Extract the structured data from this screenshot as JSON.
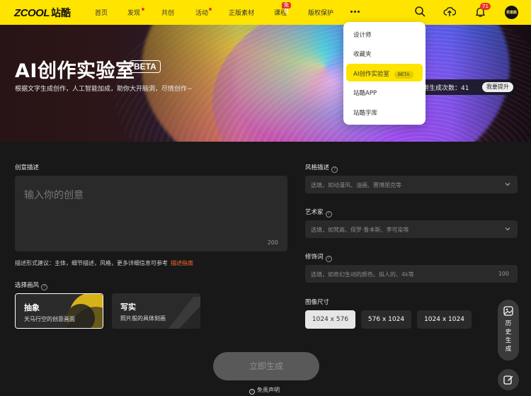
{
  "topbar": {
    "logo_en": "ZCOOL",
    "logo_cn": "站酷",
    "nav": [
      {
        "label": "首页"
      },
      {
        "label": "发现"
      },
      {
        "label": "共创"
      },
      {
        "label": "活动"
      },
      {
        "label": "正版素材"
      },
      {
        "label": "课程"
      },
      {
        "label": "版权保护"
      }
    ],
    "course_badge": "免费",
    "notification_count": "71",
    "avatar_text": "票最酷",
    "icons": [
      "search-icon",
      "upload-cloud-icon",
      "bell-icon",
      "more-dots-icon"
    ]
  },
  "dropdown": {
    "items": [
      {
        "label": "设计师"
      },
      {
        "label": "收藏夹"
      },
      {
        "label": "AI创作实验室"
      },
      {
        "label": "站酷APP"
      },
      {
        "label": "站酷字库"
      }
    ],
    "beta_badge": "BETA"
  },
  "hero": {
    "title": "AI创作实验室",
    "beta": "BETA",
    "subtitle": "根据文字生成创作，人工智能加成，助你大开脑洞，尽情创作~",
    "quota_text": "用生成次数：41",
    "quota_button": "我要提升"
  },
  "form": {
    "idea_label": "创意描述",
    "idea_placeholder": "输入你的创意",
    "idea_count": "200",
    "hint_text": "描述形式建议：主体，细节描述，风格，更多详细信息可参考",
    "hint_link": "描述指南",
    "style_label": "选择画风",
    "styles": [
      {
        "title": "抽象",
        "desc": "天马行空的创意画面"
      },
      {
        "title": "写实",
        "desc": "照片般的具体刻画"
      }
    ],
    "style_desc_label": "风格描述",
    "style_desc_placeholder": "选填，如动漫风、油画、赛博朋克等",
    "artist_label": "艺术家",
    "artist_placeholder": "选填，如梵高、保罗·鲁本斯、李可染等",
    "modifier_label": "修饰词",
    "modifier_placeholder": "选填，如奇幻生动的颜色、拟人的、4k等",
    "modifier_count": "100",
    "size_label": "图像尺寸",
    "sizes": [
      {
        "label": "1024 x 576"
      },
      {
        "label": "576 x 1024"
      },
      {
        "label": "1024 x 1024"
      }
    ],
    "generate_button": "立即生成",
    "disclaimer": "免责声明"
  },
  "side": {
    "history_label": "历史生成"
  },
  "colors": {
    "brand_yellow": "#ffe400",
    "accent_orange": "#ff6a2a",
    "badge_red": "#e8352c",
    "panel": "#2a2a2a"
  }
}
